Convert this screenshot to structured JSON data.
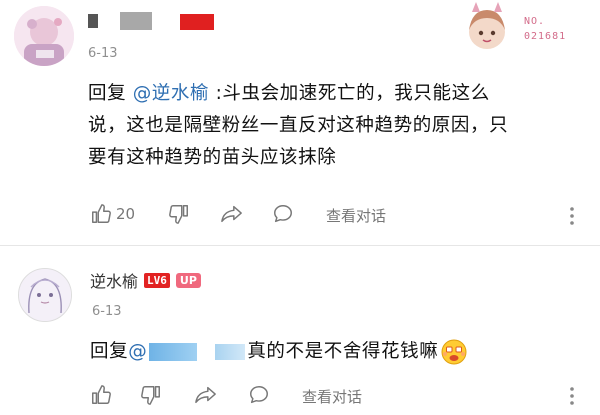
{
  "comment1": {
    "time": "6-13",
    "reply_prefix": "回复 ",
    "mention": "@逆水榆",
    "text_line1": " :斗虫会加速死亡的，我只能这么",
    "text_line2": "说，这也是隔壁粉丝一直反对这种趋势的原因，只",
    "text_line3": "要有这种趋势的苗头应该抹除",
    "like_count": "20",
    "view_replies": "查看对话",
    "fan_badge_no": "NO.",
    "fan_badge_num": "021681",
    "colors": {
      "mention": "#2f6fb2",
      "name_red": "#e02020"
    }
  },
  "comment2": {
    "username": "逆水榆",
    "level_badge": "LV6",
    "up_badge": "UP",
    "time": "6-13",
    "reply_prefix": "回复 ",
    "mention": "@",
    "text": "真的不是不舍得花钱嘛",
    "emoji": "money-face-emoji",
    "view_replies": "查看对话",
    "colors": {
      "level_badge": "#e22222",
      "up_badge": "#f0697e"
    }
  }
}
